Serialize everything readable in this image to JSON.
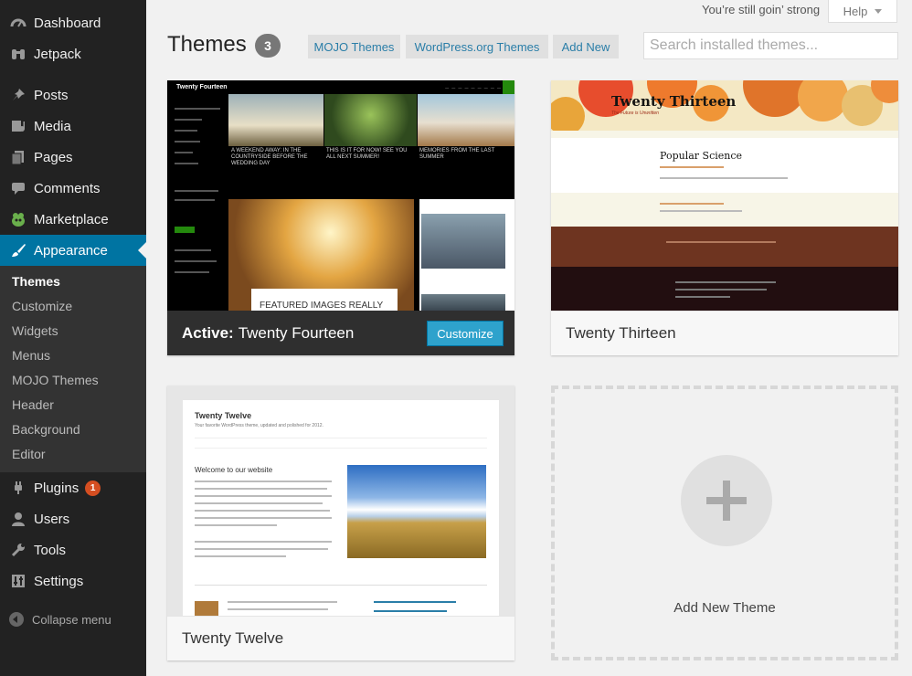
{
  "sidebar": {
    "items": [
      {
        "label": "Dashboard",
        "icon": "dashboard-icon"
      },
      {
        "label": "Jetpack",
        "icon": "jetpack-icon"
      },
      {
        "label": "Posts",
        "icon": "pushpin-icon"
      },
      {
        "label": "Media",
        "icon": "media-icon"
      },
      {
        "label": "Pages",
        "icon": "pages-icon"
      },
      {
        "label": "Comments",
        "icon": "comment-bubble-icon"
      },
      {
        "label": "Marketplace",
        "icon": "marketplace-icon"
      },
      {
        "label": "Appearance",
        "icon": "paintbrush-icon"
      }
    ],
    "appearance_submenu": [
      "Themes",
      "Customize",
      "Widgets",
      "Menus",
      "MOJO Themes",
      "Header",
      "Background",
      "Editor"
    ],
    "lower_items": [
      {
        "label": "Plugins",
        "icon": "plug-icon",
        "badge": "1"
      },
      {
        "label": "Users",
        "icon": "user-icon"
      },
      {
        "label": "Tools",
        "icon": "wrench-icon"
      },
      {
        "label": "Settings",
        "icon": "settings-icon"
      }
    ],
    "collapse_label": "Collapse menu",
    "colors": {
      "background": "#222222",
      "active": "#0074a2",
      "badge": "#d54e21"
    }
  },
  "topbar": {
    "status_text": "You’re still goin’ strong",
    "help_label": "Help"
  },
  "header": {
    "title": "Themes",
    "count": "3",
    "buttons": [
      "MOJO Themes",
      "WordPress.org Themes",
      "Add New"
    ],
    "search_placeholder": "Search installed themes..."
  },
  "themes": {
    "active": {
      "prefix": "Active:",
      "name": "Twenty Fourteen",
      "customize_label": "Customize"
    },
    "twenty_thirteen": {
      "name": "Twenty Thirteen"
    },
    "twenty_twelve": {
      "name": "Twenty Twelve"
    },
    "add_new_label": "Add New Theme"
  },
  "previews": {
    "fourteen": {
      "site_title": "Twenty Fourteen",
      "captions": [
        "A WEEKEND AWAY: IN THE COUNTRYSIDE BEFORE THE WEDDING DAY",
        "THIS IS IT FOR NOW! SEE YOU ALL NEXT SUMMER!",
        "MEMORIES FROM THE LAST SUMMER"
      ],
      "featured": "FEATURED IMAGES REALLY"
    },
    "thirteen": {
      "site_title": "Twenty Thirteen",
      "tagline": "The Future is Unwritten",
      "post_title": "Popular Science"
    },
    "twelve": {
      "site_title": "Twenty Twelve",
      "tagline": "Your favorite WordPress theme, updated and polished for 2012.",
      "welcome": "Welcome to our website"
    }
  }
}
